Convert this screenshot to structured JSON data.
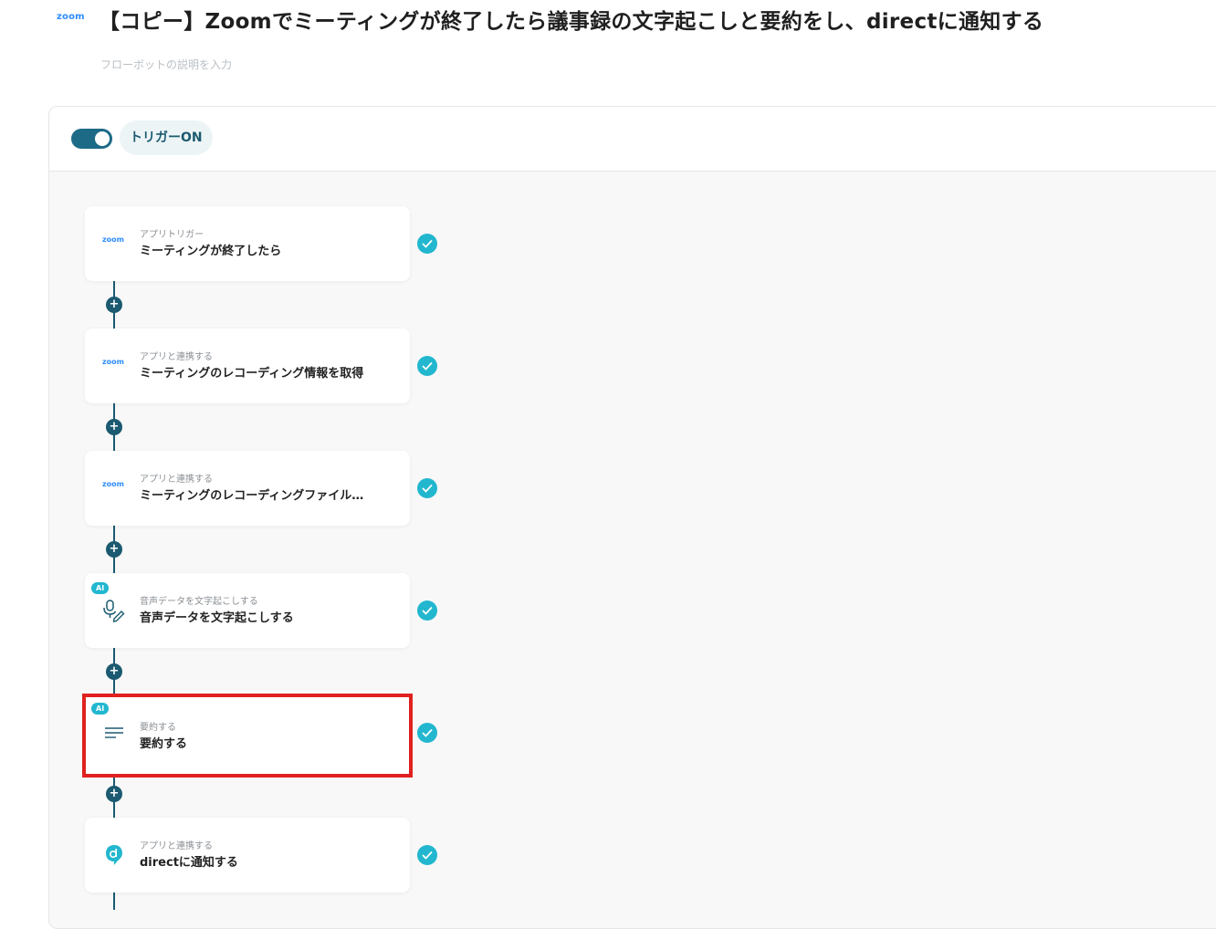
{
  "header": {
    "app_logo": "zoom",
    "title": "【コピー】Zoomでミーティングが終了したら議事録の文字起こしと要約をし、directに通知する",
    "description_placeholder": "フローボットの説明を入力"
  },
  "trigger": {
    "label": "トリガーON",
    "enabled": true
  },
  "flow": [
    {
      "icon": "zoom",
      "subtitle": "アプリトリガー",
      "title": "ミーティングが終了したら",
      "status": "complete"
    },
    {
      "icon": "zoom",
      "subtitle": "アプリと連携する",
      "title": "ミーティングのレコーディング情報を取得",
      "status": "complete"
    },
    {
      "icon": "zoom",
      "subtitle": "アプリと連携する",
      "title": "ミーティングのレコーディングファイル…",
      "status": "complete"
    },
    {
      "icon": "mic-pen",
      "badge": "AI",
      "subtitle": "音声データを文字起こしする",
      "title": "音声データを文字起こしする",
      "status": "complete"
    },
    {
      "icon": "lines",
      "badge": "AI",
      "subtitle": "要約する",
      "title": "要約する",
      "status": "complete",
      "highlighted": true
    },
    {
      "icon": "direct",
      "subtitle": "アプリと連携する",
      "title": "directに通知する",
      "status": "complete"
    }
  ],
  "colors": {
    "primary": "#1b5a70",
    "check": "#22b7cf",
    "highlight": "#e0211f",
    "zoom": "#2D8CFF"
  }
}
